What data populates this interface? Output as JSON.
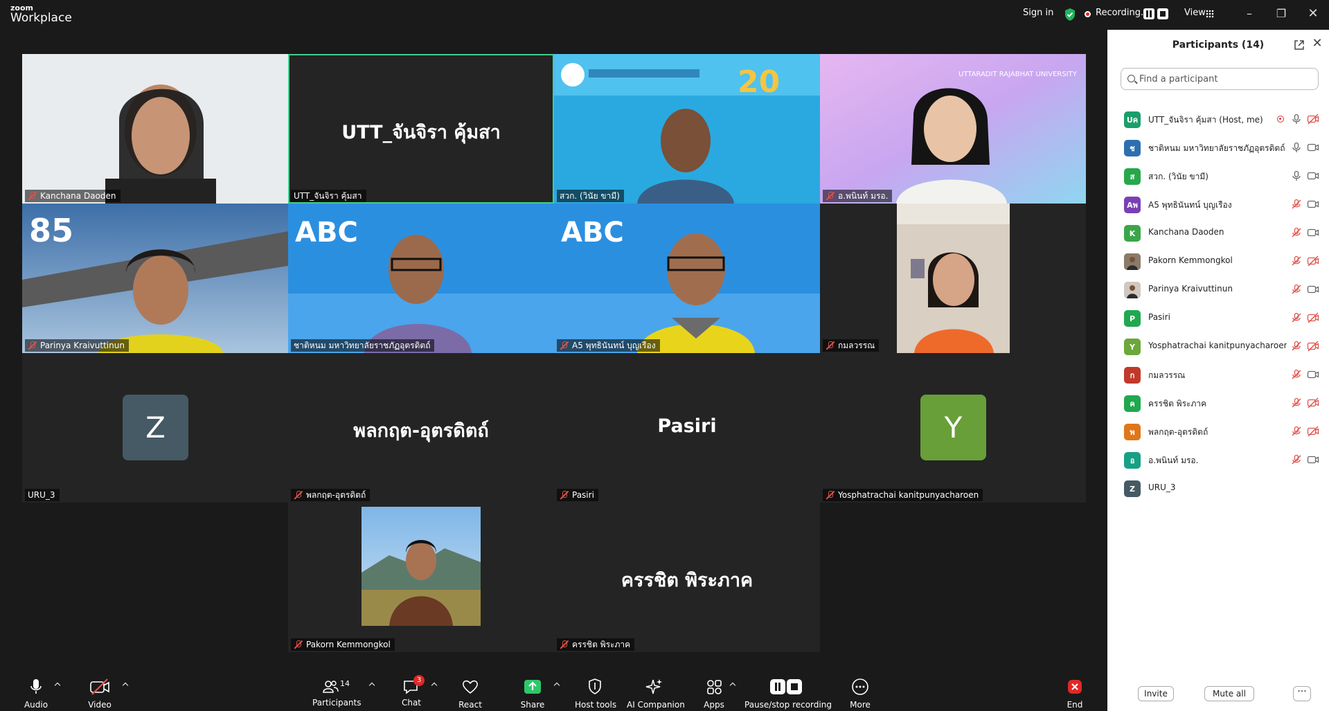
{
  "app": {
    "logo_top": "zoom",
    "logo_bottom": "Workplace",
    "sign_in": "Sign in",
    "recording_label": "Recording...",
    "view_label": "View"
  },
  "gallery": {
    "tiles": [
      {
        "name": "Kanchana Daoden",
        "muted": true
      },
      {
        "name": "UTT_จันจิรา คุ้มสา",
        "display_name": "UTT_จันจิรา คุ้มสา",
        "muted": false
      },
      {
        "name": "สวก. (วินัย ขามี)",
        "muted": false
      },
      {
        "name": "อ.พนินท์ มรอ.",
        "muted": true
      },
      {
        "name": "Parinya Kraivuttinun",
        "muted": true
      },
      {
        "name": "ชาติหนม มหาวิทยาลัยราชภัฏอุตรดิตถ์",
        "muted": false
      },
      {
        "name": "A5 พุทธินันทน์ บุญเรือง",
        "muted": true
      },
      {
        "name": "กมลวรรณ",
        "muted": true
      },
      {
        "name": "URU_3",
        "avatar_letter": "Z",
        "muted": false
      },
      {
        "name": "พลกฤต-อุตรดิตถ์",
        "display_name": "พลกฤต-อุตรดิตถ์",
        "muted": true
      },
      {
        "name": "Pasiri",
        "display_name": "Pasiri",
        "muted": true
      },
      {
        "name": "Yosphatrachai kanitpunyacharoen",
        "avatar_letter": "Y",
        "muted": true
      },
      {
        "name": "Pakorn Kemmongkol",
        "muted": true
      },
      {
        "name": "ครรชิต พิระภาค",
        "display_name": "ครรชิต พิระภาค",
        "muted": true
      }
    ]
  },
  "panel": {
    "title": "Participants (14)",
    "search_placeholder": "Find a participant",
    "participants": [
      {
        "avatar": "Uค",
        "color": "#1a9e6a",
        "name": "UTT_จันจิรา คุ้มสา (Host, me)",
        "mic": "on",
        "cam": "off",
        "recording": true
      },
      {
        "avatar": "ช",
        "color": "#2e6fb0",
        "name": "ชาติหนม มหาวิทยาลัยราชภัฏอุตรดิตถ์",
        "mic": "on",
        "cam": "on"
      },
      {
        "avatar": "ส",
        "color": "#26a84a",
        "name": "สวก. (วินัย ขามี)",
        "mic": "on",
        "cam": "on"
      },
      {
        "avatar": "Aพ",
        "color": "#7a3fb5",
        "name": "A5 พุทธินันทน์ บุญเรือง",
        "mic": "off",
        "cam": "on"
      },
      {
        "avatar": "K",
        "color": "#3aa648",
        "name": "Kanchana Daoden",
        "mic": "off",
        "cam": "on"
      },
      {
        "avatar": "",
        "color": "#8a7b6a",
        "name": "Pakorn Kemmongkol",
        "mic": "off",
        "cam": "off"
      },
      {
        "avatar": "",
        "color": "#d0c8c0",
        "name": "Parinya Kraivuttinun",
        "mic": "off",
        "cam": "on"
      },
      {
        "avatar": "P",
        "color": "#1fa84f",
        "name": "Pasiri",
        "mic": "off",
        "cam": "off"
      },
      {
        "avatar": "Y",
        "color": "#6aa83a",
        "name": "Yosphatrachai kanitpunyacharoen",
        "mic": "off",
        "cam": "off"
      },
      {
        "avatar": "ก",
        "color": "#c0392b",
        "name": "กมลวรรณ",
        "mic": "off",
        "cam": "on"
      },
      {
        "avatar": "ค",
        "color": "#1fa84f",
        "name": "ครรชิต พิระภาค",
        "mic": "off",
        "cam": "off"
      },
      {
        "avatar": "พ",
        "color": "#e0761a",
        "name": "พลกฤต-อุตรดิตถ์",
        "mic": "off",
        "cam": "off"
      },
      {
        "avatar": "อ",
        "color": "#16a085",
        "name": "อ.พนินท์ มรอ.",
        "mic": "off",
        "cam": "on"
      },
      {
        "avatar": "Z",
        "color": "#455a64",
        "name": "URU_3",
        "mic": "none",
        "cam": "none"
      }
    ],
    "invite_label": "Invite",
    "mute_all_label": "Mute all",
    "more_label": "···"
  },
  "toolbar": {
    "audio": "Audio",
    "video": "Video",
    "participants": "Participants",
    "participants_count": "14",
    "chat": "Chat",
    "chat_badge": "3",
    "react": "React",
    "share": "Share",
    "host_tools": "Host tools",
    "ai_companion": "AI Companion",
    "apps": "Apps",
    "pause_stop_recording": "Pause/stop recording",
    "more": "More",
    "end": "End"
  },
  "colors": {
    "accent_green": "#3ecf8e",
    "end_red": "#e02828",
    "muted_red": "#e0524a"
  }
}
